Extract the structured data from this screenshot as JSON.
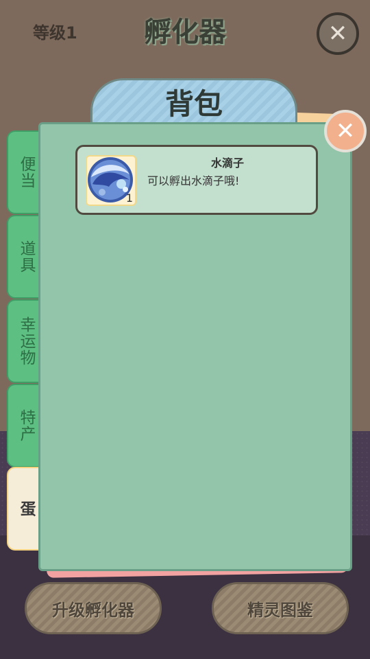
{
  "header": {
    "level_label": "等级1",
    "title": "孵化器"
  },
  "bag": {
    "title": "背包",
    "tabs": [
      {
        "label": "便当",
        "active": false
      },
      {
        "label": "道具",
        "active": false
      },
      {
        "label": "幸运物",
        "active": false
      },
      {
        "label": "特产",
        "active": false
      },
      {
        "label": "蛋",
        "active": true
      }
    ],
    "items": [
      {
        "name": "水滴子",
        "description": "可以孵出水滴子哦!",
        "count": "1",
        "icon": "water-drop-orb-icon"
      }
    ]
  },
  "footer": {
    "upgrade_label": "升级孵化器",
    "dex_label": "精灵图鉴"
  },
  "colors": {
    "panel_bg": "#93c5aa",
    "tab_green": "#5dbf82",
    "active_tab": "#f6edd8",
    "close_accent": "#f2b08d"
  }
}
